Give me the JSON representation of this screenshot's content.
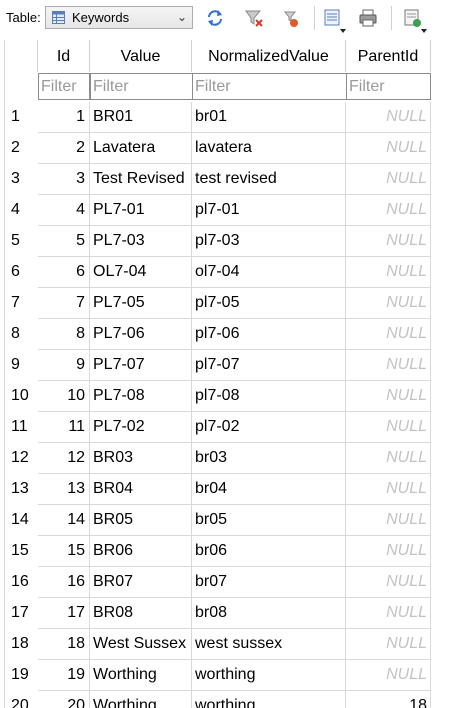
{
  "toolbar": {
    "table_label": "Table:",
    "selected_table": "Keywords",
    "buttons": [
      "refresh-icon",
      "clear-filters-icon",
      "save-filter-icon",
      "insert-record-icon",
      "print-icon",
      "new-record-icon"
    ]
  },
  "grid": {
    "columns": [
      "Id",
      "Value",
      "NormalizedValue",
      "ParentId"
    ],
    "filter_placeholder": "Filter",
    "null_text": "NULL",
    "rows": [
      {
        "row": "1",
        "id": "1",
        "value": "BR01",
        "normalized": "br01",
        "parent": "NULL"
      },
      {
        "row": "2",
        "id": "2",
        "value": "Lavatera",
        "normalized": "lavatera",
        "parent": "NULL"
      },
      {
        "row": "3",
        "id": "3",
        "value": "Test Revised",
        "normalized": "test revised",
        "parent": "NULL"
      },
      {
        "row": "4",
        "id": "4",
        "value": "PL7-01",
        "normalized": "pl7-01",
        "parent": "NULL"
      },
      {
        "row": "5",
        "id": "5",
        "value": "PL7-03",
        "normalized": "pl7-03",
        "parent": "NULL"
      },
      {
        "row": "6",
        "id": "6",
        "value": "OL7-04",
        "normalized": "ol7-04",
        "parent": "NULL"
      },
      {
        "row": "7",
        "id": "7",
        "value": "PL7-05",
        "normalized": "pl7-05",
        "parent": "NULL"
      },
      {
        "row": "8",
        "id": "8",
        "value": "PL7-06",
        "normalized": "pl7-06",
        "parent": "NULL"
      },
      {
        "row": "9",
        "id": "9",
        "value": "PL7-07",
        "normalized": "pl7-07",
        "parent": "NULL"
      },
      {
        "row": "10",
        "id": "10",
        "value": "PL7-08",
        "normalized": "pl7-08",
        "parent": "NULL"
      },
      {
        "row": "11",
        "id": "11",
        "value": "PL7-02",
        "normalized": "pl7-02",
        "parent": "NULL"
      },
      {
        "row": "12",
        "id": "12",
        "value": "BR03",
        "normalized": "br03",
        "parent": "NULL"
      },
      {
        "row": "13",
        "id": "13",
        "value": "BR04",
        "normalized": "br04",
        "parent": "NULL"
      },
      {
        "row": "14",
        "id": "14",
        "value": "BR05",
        "normalized": "br05",
        "parent": "NULL"
      },
      {
        "row": "15",
        "id": "15",
        "value": "BR06",
        "normalized": "br06",
        "parent": "NULL"
      },
      {
        "row": "16",
        "id": "16",
        "value": "BR07",
        "normalized": "br07",
        "parent": "NULL"
      },
      {
        "row": "17",
        "id": "17",
        "value": "BR08",
        "normalized": "br08",
        "parent": "NULL"
      },
      {
        "row": "18",
        "id": "18",
        "value": "West Sussex",
        "normalized": "west sussex",
        "parent": "NULL"
      },
      {
        "row": "19",
        "id": "19",
        "value": "Worthing",
        "normalized": "worthing",
        "parent": "NULL"
      },
      {
        "row": "20",
        "id": "20",
        "value": "Worthing",
        "normalized": "worthing",
        "parent": "18"
      }
    ]
  }
}
